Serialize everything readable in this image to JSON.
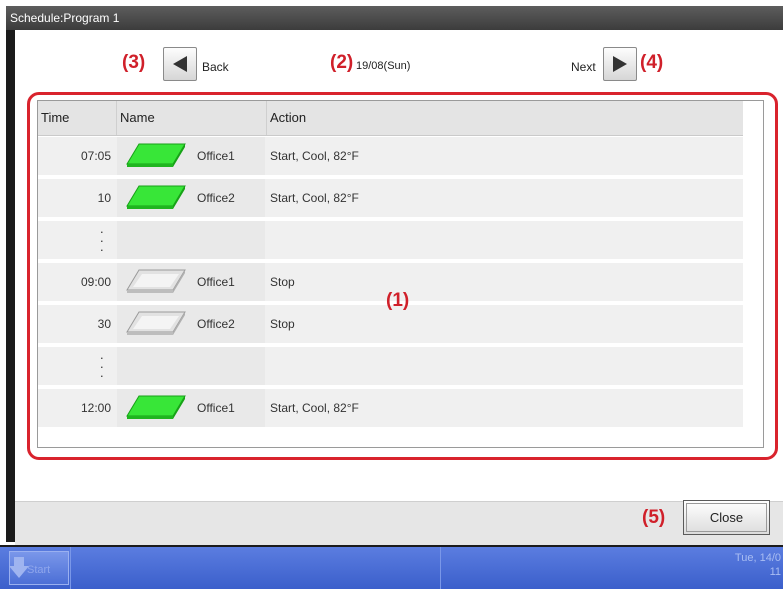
{
  "window": {
    "title": "Schedule:Program 1"
  },
  "nav": {
    "back_label": "Back",
    "next_label": "Next",
    "date": "19/08(Sun)"
  },
  "callouts": {
    "list": "(1)",
    "date": "(2)",
    "back": "(3)",
    "next": "(4)",
    "close": "(5)"
  },
  "columns": {
    "time": "Time",
    "name": "Name",
    "action": "Action"
  },
  "rows": [
    {
      "time": "07:05",
      "name": "Office1",
      "action": "Start, Cool, 82°F",
      "state": "on"
    },
    {
      "time": "10",
      "name": "Office2",
      "action": "Start, Cool, 82°F",
      "state": "on"
    },
    {
      "time": "09:00",
      "name": "Office1",
      "action": "Stop",
      "state": "off"
    },
    {
      "time": "30",
      "name": "Office2",
      "action": "Stop",
      "state": "off"
    },
    {
      "time": "12:00",
      "name": "Office1",
      "action": "Start, Cool, 82°F",
      "state": "on"
    }
  ],
  "buttons": {
    "close_label": "Close"
  },
  "taskbar": {
    "start_label": "Start",
    "clock_line1": "Tue, 14/0",
    "clock_line2": "11"
  },
  "colors": {
    "accent_red": "#d9232d",
    "tile_on": "#33e033",
    "tile_off": "#d4d4d4"
  }
}
